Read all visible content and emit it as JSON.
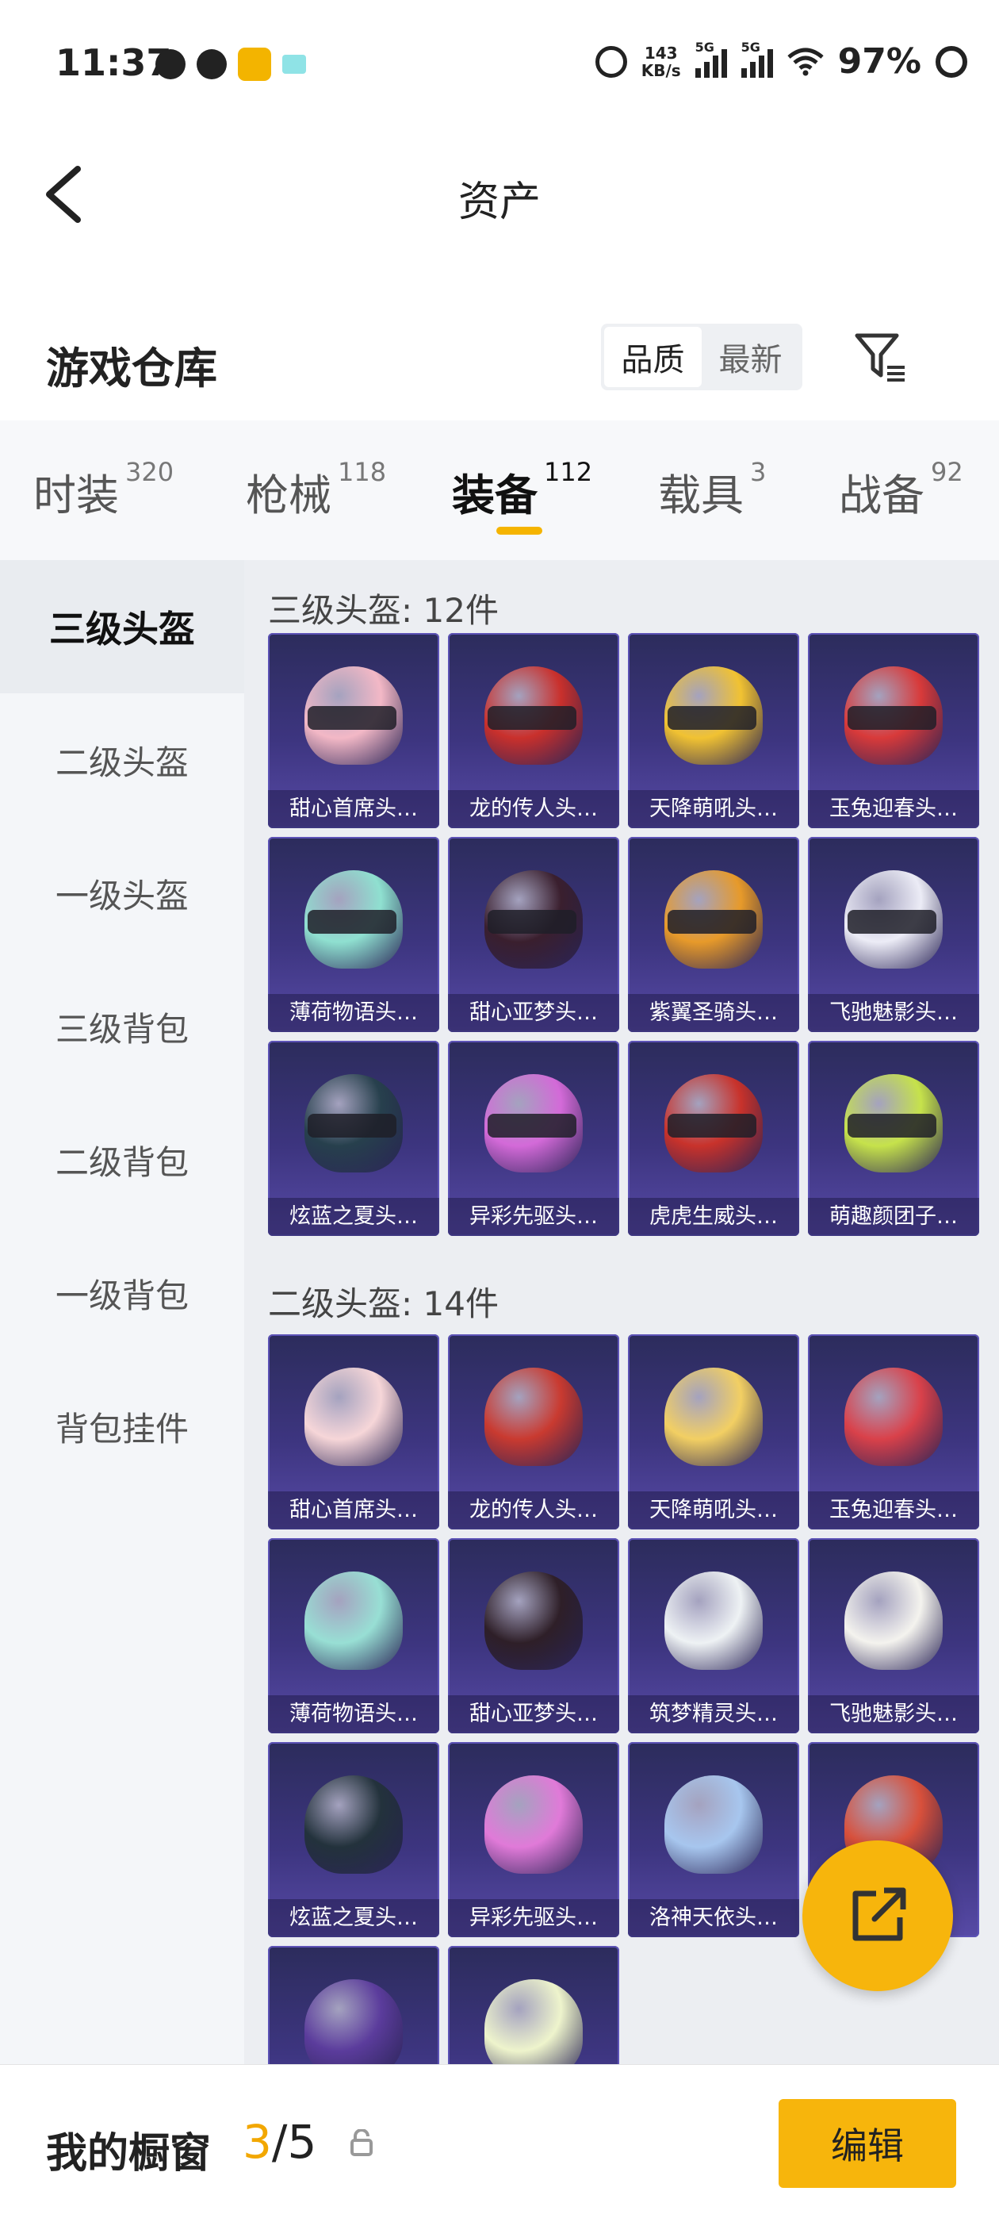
{
  "status_bar": {
    "time": "11:37",
    "net_speed_top": "143",
    "net_speed_bottom": "KB/s",
    "sim1": "5G",
    "sim2": "5G",
    "battery": "97%"
  },
  "nav": {
    "title": "资产"
  },
  "warehouse": {
    "title": "游戏仓库",
    "sort_options": [
      {
        "label": "品质",
        "active": true
      },
      {
        "label": "最新",
        "active": false
      }
    ]
  },
  "tabs": [
    {
      "label": "时装",
      "count": "320"
    },
    {
      "label": "枪械",
      "count": "118"
    },
    {
      "label": "装备",
      "count": "112",
      "active": true
    },
    {
      "label": "载具",
      "count": "3"
    },
    {
      "label": "战备",
      "count": "92"
    }
  ],
  "sidebar": {
    "items": [
      {
        "label": "三级头盔",
        "active": true
      },
      {
        "label": "二级头盔"
      },
      {
        "label": "一级头盔"
      },
      {
        "label": "三级背包"
      },
      {
        "label": "二级背包"
      },
      {
        "label": "一级背包"
      },
      {
        "label": "背包挂件"
      }
    ]
  },
  "sections": [
    {
      "title": "三级头盔: 12件",
      "items": [
        {
          "name": "甜心首席头…",
          "color": "#f3b8c6"
        },
        {
          "name": "龙的传人头…",
          "color": "#c9302c"
        },
        {
          "name": "天降萌吼头…",
          "color": "#f1c232"
        },
        {
          "name": "玉兔迎春头…",
          "color": "#d83a3a"
        },
        {
          "name": "薄荷物语头…",
          "color": "#8fe0d0"
        },
        {
          "name": "甜心亚梦头…",
          "color": "#3a1f2e"
        },
        {
          "name": "紫翼圣骑头…",
          "color": "#e79a2a"
        },
        {
          "name": "飞驰魅影头…",
          "color": "#ececf6"
        },
        {
          "name": "炫蓝之夏头…",
          "color": "#27404d"
        },
        {
          "name": "异彩先驱头…",
          "color": "#d36ad8"
        },
        {
          "name": "虎虎生威头…",
          "color": "#c8322b"
        },
        {
          "name": "萌趣颜团子…",
          "color": "#c6e24b"
        }
      ]
    },
    {
      "title": "二级头盔: 14件",
      "items": [
        {
          "name": "甜心首席头…",
          "color": "#f6d6d8"
        },
        {
          "name": "龙的传人头…",
          "color": "#c93a30"
        },
        {
          "name": "天降萌吼头…",
          "color": "#f2cf63"
        },
        {
          "name": "玉兔迎春头…",
          "color": "#d9414a"
        },
        {
          "name": "薄荷物语头…",
          "color": "#98dfd4"
        },
        {
          "name": "甜心亚梦头…",
          "color": "#2e1f28"
        },
        {
          "name": "筑梦精灵头…",
          "color": "#eef2f4"
        },
        {
          "name": "飞驰魅影头…",
          "color": "#f4f3ee"
        },
        {
          "name": "炫蓝之夏头…",
          "color": "#23323c"
        },
        {
          "name": "异彩先驱头…",
          "color": "#e07ad8"
        },
        {
          "name": "洛神天依头…",
          "color": "#a7c6ee"
        },
        {
          "name": "",
          "color": "#d8503b"
        },
        {
          "name": "",
          "color": "#5b3c9c"
        },
        {
          "name": "",
          "color": "#eef4cc"
        }
      ]
    }
  ],
  "showcase": {
    "title": "我的橱窗",
    "current": "3",
    "separator": "/5",
    "edit_label": "编辑"
  }
}
